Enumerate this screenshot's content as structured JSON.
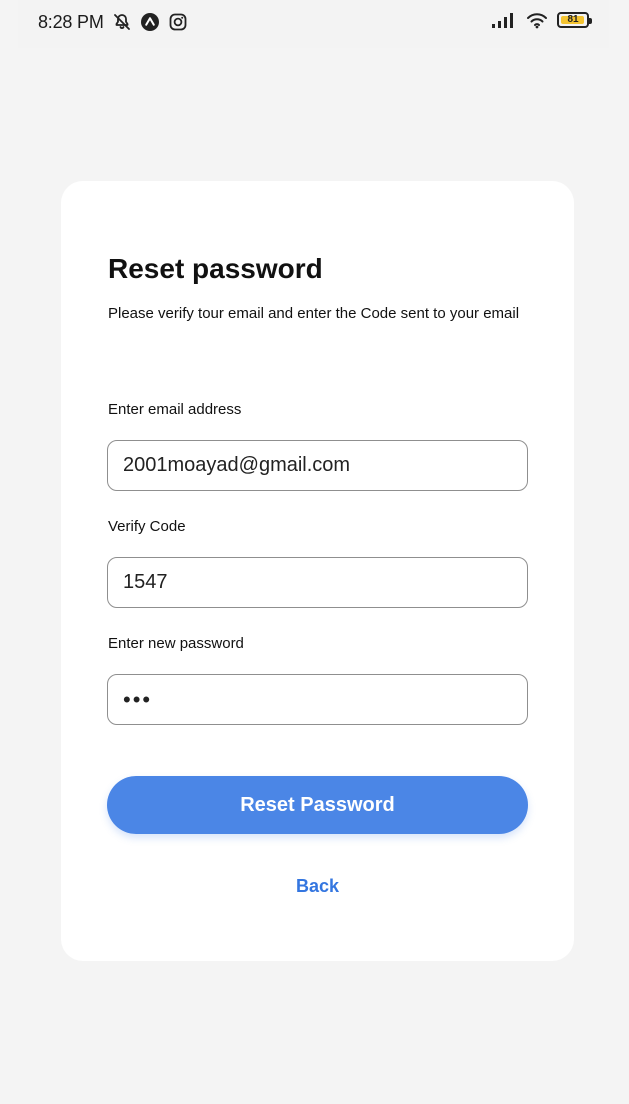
{
  "status_bar": {
    "time": "8:28 PM",
    "left_icons": [
      "notification-muted-icon",
      "app-notification-icon",
      "instagram-icon"
    ],
    "right_icons": [
      "signal-icon",
      "wifi-icon",
      "battery-icon"
    ],
    "battery_level": "81"
  },
  "reset": {
    "title": "Reset password",
    "subtitle": "Please verify tour email and enter the Code sent to your email",
    "email_label": "Enter email address",
    "email_value": "2001moayad@gmail.com",
    "code_label": "Verify Code",
    "code_value": "1547",
    "password_label": "Enter new password",
    "password_value": "•••",
    "submit_label": "Reset Password",
    "back_label": "Back"
  },
  "colors": {
    "background": "#f4f4f4",
    "card": "#ffffff",
    "primary": "#4b86e6",
    "link": "#3476e0",
    "border": "#8f8f8f"
  }
}
